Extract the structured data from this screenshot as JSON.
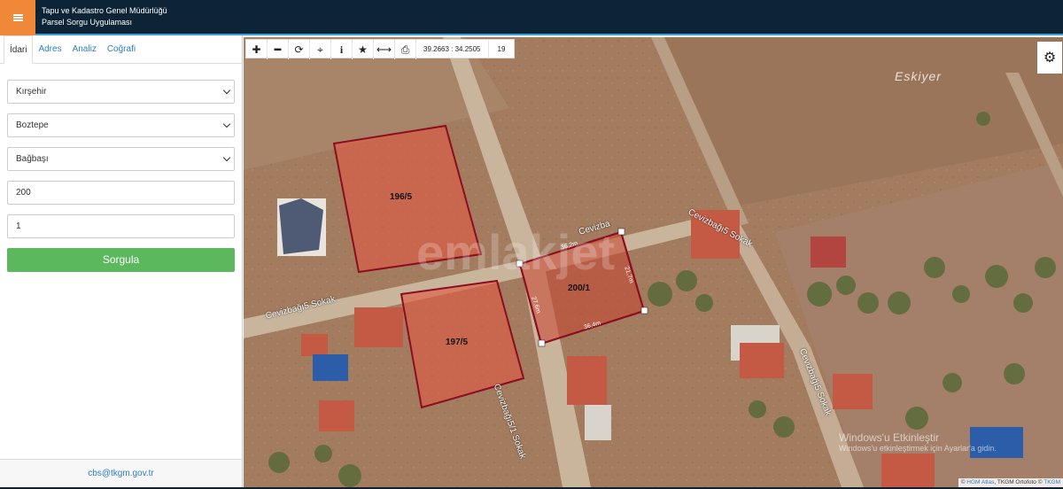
{
  "header": {
    "title_line1": "Tapu ve Kadastro Genel Müdürlüğü",
    "title_line2": "Parsel Sorgu Uygulaması"
  },
  "sidebar": {
    "tabs": [
      {
        "label": "İdari",
        "active": true
      },
      {
        "label": "Adres",
        "active": false
      },
      {
        "label": "Analiz",
        "active": false
      },
      {
        "label": "Coğrafi",
        "active": false
      }
    ],
    "province": "Kırşehir",
    "district": "Boztepe",
    "neighborhood": "Bağbaşı",
    "block": "200",
    "parcel": "1",
    "search_label": "Sorgula",
    "footer_email": "cbs@tkgm.gov.tr"
  },
  "toolbar": {
    "coordinates": "39.2663 : 34.2505",
    "zoom_level": "19"
  },
  "map": {
    "place_label": "Eskiyer",
    "parcels": [
      {
        "label": "196/5"
      },
      {
        "label": "197/5"
      },
      {
        "label": "200/1"
      }
    ],
    "streets": [
      "Cevizbağı5 Sokak",
      "Cevizbağı5/1 Sokak",
      "Cevizbağı5 Sokak",
      "Cevizbağı5 Sokak",
      "Cevizba"
    ],
    "dimensions": [
      "36,2m",
      "21,7m",
      "27,6m",
      "36,4m"
    ],
    "watermark": "emlakjet",
    "os_notice_line1": "Windows'u Etkinleştir",
    "os_notice_line2": "Windows'u etkinleştirmek için Ayarlar'a gidin.",
    "attribution_prefix": "©",
    "attribution_hgm": "HGM Atlas",
    "attribution_mid": ", TKGM Ortofoto ©",
    "attribution_tkgm": "TKGM"
  },
  "colors": {
    "header_bg": "#0d2437",
    "menu_accent": "#f0883a",
    "search_button": "#5cb85c",
    "parcel_fill": "#e05a44",
    "parcel_stroke": "#8b0d1f"
  }
}
